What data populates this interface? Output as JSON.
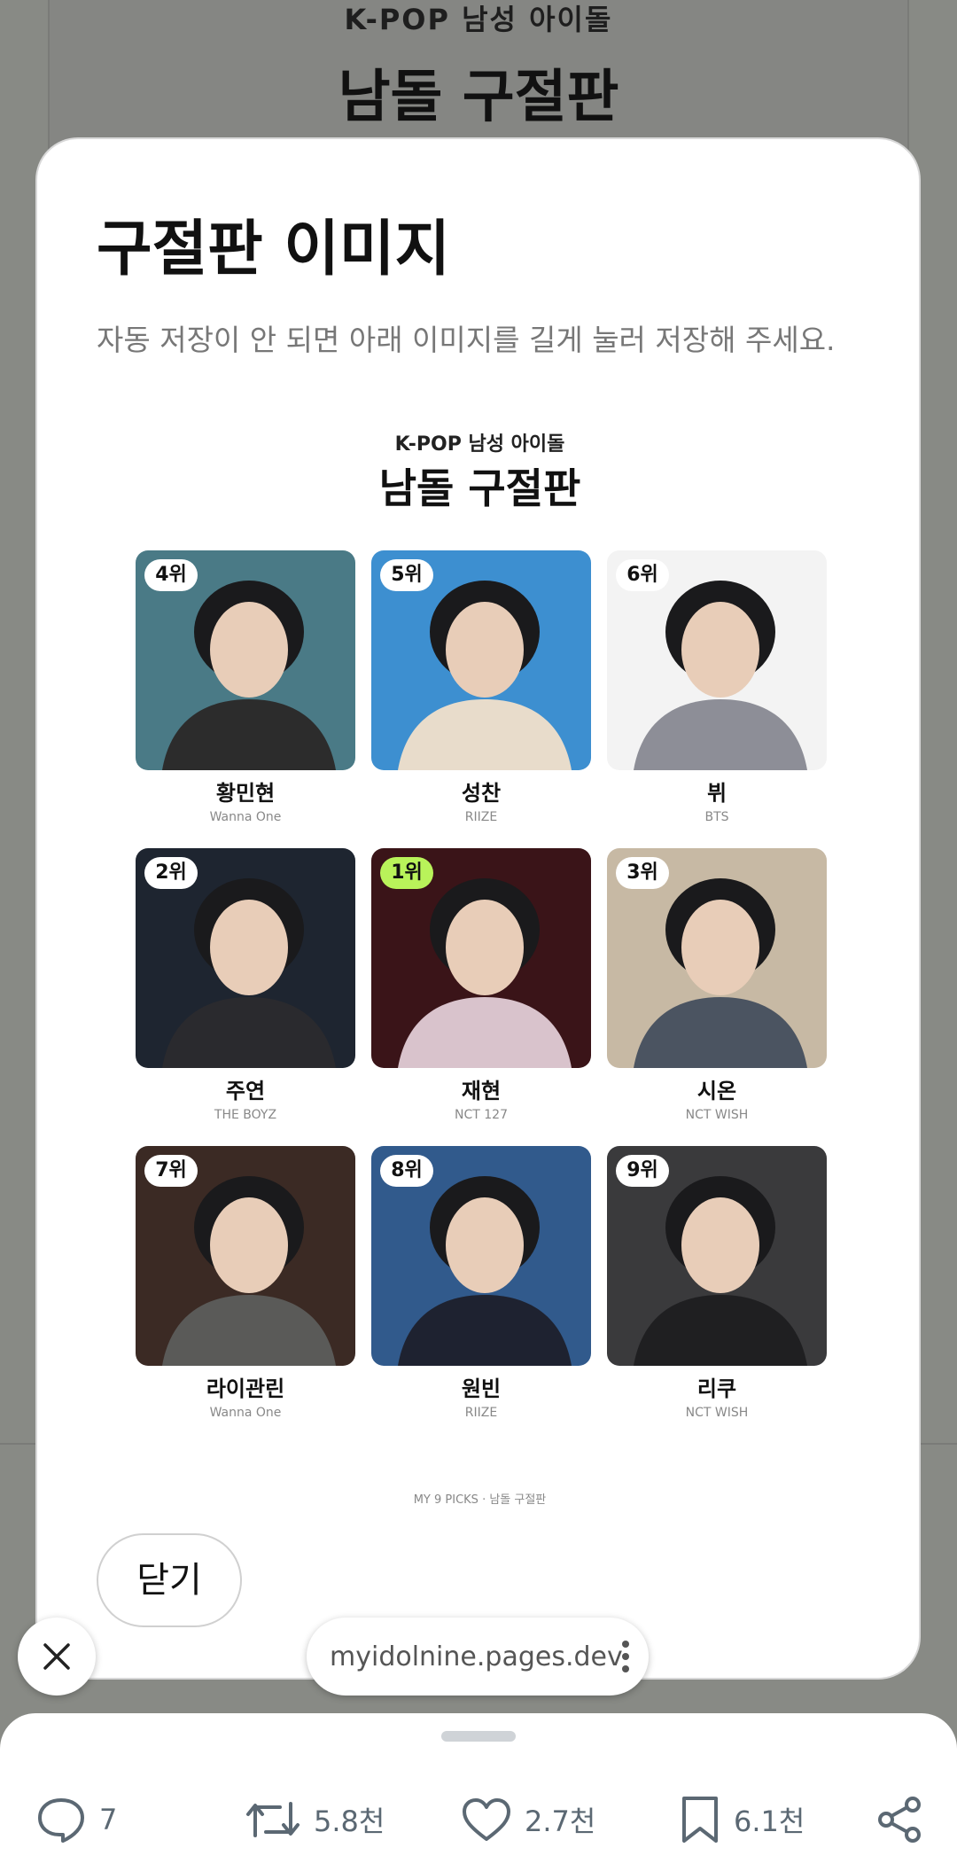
{
  "background": {
    "subtitle": "K-POP 남성 아이돌",
    "title": "남돌 구절판"
  },
  "modal": {
    "title": "구절판 이미지",
    "description": "자동 저장이 안 되면 아래 이미지를 길게 눌러 저장해 주세요.",
    "card_subtitle": "K-POP 남성 아이돌",
    "card_title": "남돌 구절판",
    "footer_note": "MY 9 PICKS · 남돌 구절판",
    "close_label": "닫기",
    "idols": [
      {
        "rank": "4위",
        "name": "황민현",
        "group": "Wanna One",
        "bg": "#4a7a86",
        "tone": "#2c2c2c"
      },
      {
        "rank": "5위",
        "name": "성찬",
        "group": "RIIZE",
        "bg": "#3d8fd0",
        "tone": "#e8dccb"
      },
      {
        "rank": "6위",
        "name": "뷔",
        "group": "BTS",
        "bg": "#f3f3f3",
        "tone": "#8d8e97"
      },
      {
        "rank": "2위",
        "name": "주연",
        "group": "THE BOYZ",
        "bg": "#1e2530",
        "tone": "#2a2a2e"
      },
      {
        "rank": "1위",
        "name": "재현",
        "group": "NCT 127",
        "bg": "#3a1418",
        "tone": "#d9c3cc"
      },
      {
        "rank": "3위",
        "name": "시온",
        "group": "NCT WISH",
        "bg": "#c7b9a4",
        "tone": "#4b5461"
      },
      {
        "rank": "7위",
        "name": "라이관린",
        "group": "Wanna One",
        "bg": "#3b2a24",
        "tone": "#5a5a58"
      },
      {
        "rank": "8위",
        "name": "원빈",
        "group": "RIIZE",
        "bg": "#315a8c",
        "tone": "#1e2230"
      },
      {
        "rank": "9위",
        "name": "리쿠",
        "group": "NCT WISH",
        "bg": "#3a3a3c",
        "tone": "#1f1f21"
      }
    ]
  },
  "browser": {
    "url": "myidolnine.pages.dev"
  },
  "actions": {
    "replies": "7",
    "reposts": "5.8천",
    "likes": "2.7천",
    "bookmarks": "6.1천"
  },
  "colors": {
    "rank_highlight": "#b9f35a",
    "action_icon": "#5b6873"
  }
}
